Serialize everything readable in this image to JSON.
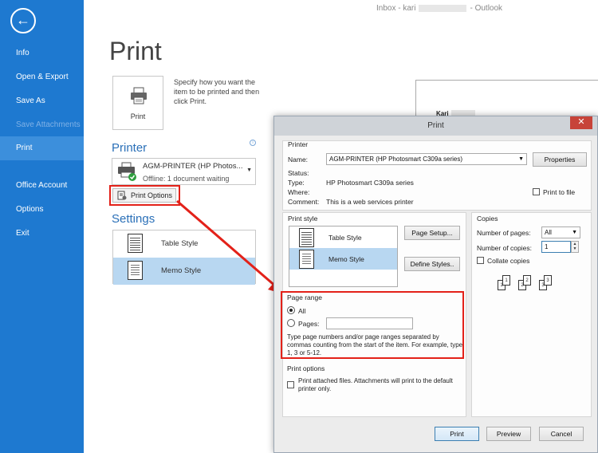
{
  "window_title": "Inbox - kari",
  "window_title_app": "Outlook",
  "sidebar": {
    "items": [
      {
        "label": "Info"
      },
      {
        "label": "Open & Export"
      },
      {
        "label": "Save As"
      },
      {
        "label": "Save Attachments"
      },
      {
        "label": "Print"
      },
      {
        "label": "Office Account"
      },
      {
        "label": "Options"
      },
      {
        "label": "Exit"
      }
    ]
  },
  "backstage": {
    "title": "Print",
    "print_button": "Print",
    "print_description": "Specify how you want the item to be printed and then click Print.",
    "printer_heading": "Printer",
    "printer_name": "AGM-PRINTER (HP Photos...",
    "printer_status": "Offline: 1 document waiting",
    "print_options_button": "Print Options",
    "settings_heading": "Settings",
    "styles": [
      {
        "label": "Table Style"
      },
      {
        "label": "Memo Style"
      }
    ]
  },
  "preview": {
    "sender": "Kari"
  },
  "dialog": {
    "title": "Print",
    "close": "✕",
    "printer_group": "Printer",
    "name_label": "Name:",
    "name_value": "AGM-PRINTER (HP Photosmart C309a series)",
    "properties_button": "Properties",
    "status_label": "Status:",
    "type_label": "Type:",
    "type_value": "HP Photosmart C309a series",
    "where_label": "Where:",
    "comment_label": "Comment:",
    "comment_value": "This is a web services printer",
    "print_to_file": "Print to file",
    "print_style_group": "Print style",
    "styles": [
      {
        "label": "Table Style"
      },
      {
        "label": "Memo Style"
      }
    ],
    "page_setup_button": "Page Setup...",
    "define_styles_button": "Define Styles..",
    "copies_group": "Copies",
    "num_pages_label": "Number of pages:",
    "num_pages_value": "All",
    "num_copies_label": "Number of copies:",
    "num_copies_value": "1",
    "collate_label": "Collate copies",
    "collate_pages": [
      "1",
      "1",
      "2",
      "2",
      "3",
      "3"
    ],
    "page_range_group": "Page range",
    "all_label": "All",
    "pages_label": "Pages:",
    "pages_value": "",
    "range_help": "Type page numbers and/or page ranges separated by commas counting from the start of the item.  For example, type 1, 3 or 5-12.",
    "print_options_group": "Print options",
    "attached_files_label": "Print attached files.  Attachments will print to the default printer only.",
    "print_button": "Print",
    "preview_button": "Preview",
    "cancel_button": "Cancel"
  },
  "colors": {
    "sidebar": "#1e79d0",
    "sidebar_active": "#3c8fdc",
    "callout": "#e32119",
    "selected_style": "#b8d7f1"
  }
}
